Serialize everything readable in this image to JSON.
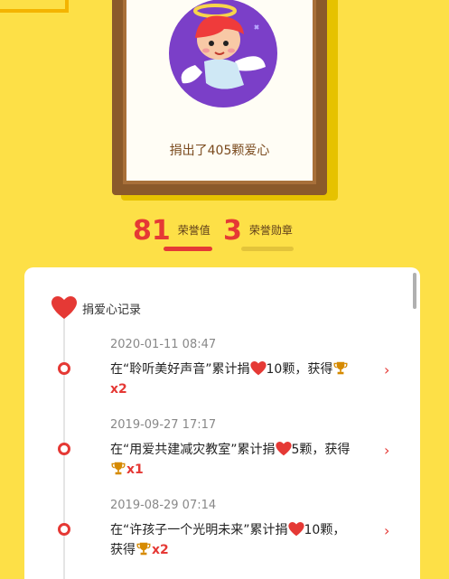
{
  "portrait": {
    "donate_text": "捐出了405颗爱心"
  },
  "stats": {
    "honor_value": "81",
    "honor_value_label": "荣誉值",
    "medal_count": "3",
    "medal_label": "荣誉勋章"
  },
  "records_card": {
    "title": "捐爱心记录",
    "items": [
      {
        "date": "2020-01-11 08:47",
        "prefix": "在“聆听美好声音”累计捐",
        "hearts": "10颗，获得",
        "trophies": "x2"
      },
      {
        "date": "2019-09-27 17:17",
        "prefix": "在“用爱共建减灾教室”累计捐",
        "hearts": "5颗，获得",
        "trophies": "x1"
      },
      {
        "date": "2019-08-29 07:14",
        "prefix": "在“许孩子一个光明未来”累计捐",
        "hearts": "10颗，",
        "suffix": "获得",
        "trophies": "x2"
      }
    ]
  },
  "colors": {
    "background": "#fde047",
    "accent_red": "#e53935",
    "frame_brown": "#8b5a2b"
  },
  "icons": [
    "heart-icon",
    "trophy-icon",
    "chevron-right-icon",
    "angel-avatar-icon"
  ]
}
